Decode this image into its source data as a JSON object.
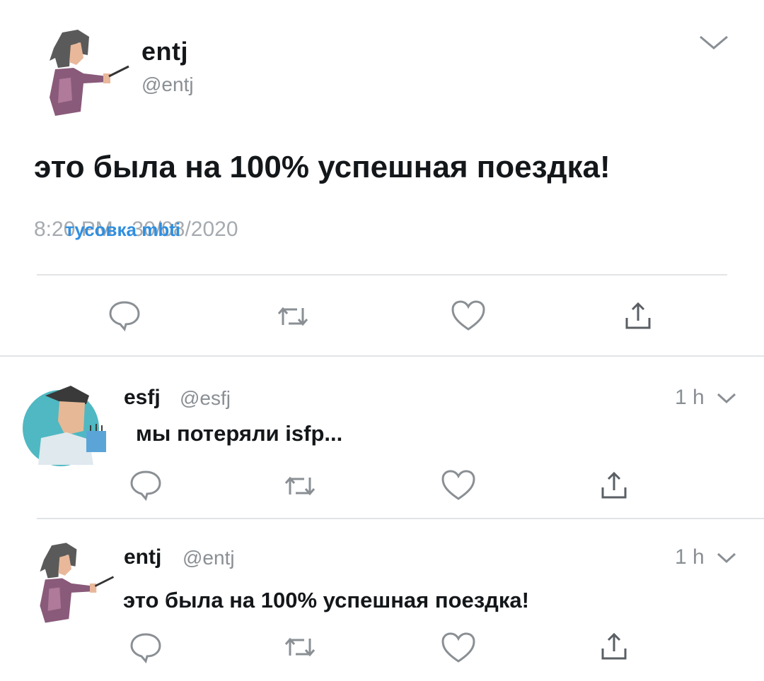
{
  "main_tweet": {
    "name": "entj",
    "handle": "@entj",
    "text": "это была на 100% успешная поездка!",
    "timestamp": "8:20 PM · 30/08/2020",
    "watermark": "тусовка mbti"
  },
  "replies": [
    {
      "name": "esfj",
      "handle": "@esfj",
      "text": "мы потеряли isfp...",
      "time": "1 h"
    },
    {
      "name": "entj",
      "handle": "@entj",
      "text": "это была на 100% успешная поездка!",
      "time": "1 h"
    }
  ],
  "icons": [
    "reply-icon",
    "retweet-icon",
    "like-icon",
    "share-icon",
    "chevron-down-icon"
  ],
  "colors": {
    "text": "#14171a",
    "muted": "#8a8f94",
    "watermark": "#2f8fe0",
    "divider": "#e1e4e6"
  }
}
